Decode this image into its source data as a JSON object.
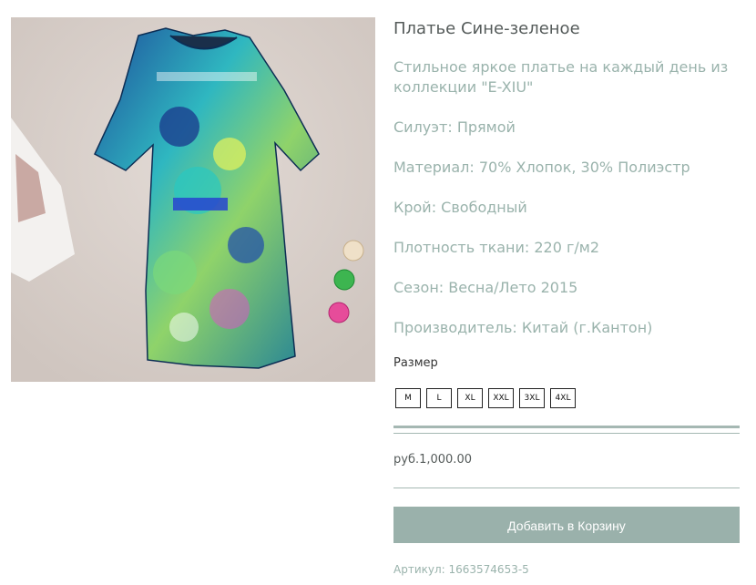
{
  "product": {
    "title": "Платье Сине-зеленое",
    "description": "Стильное яркое платье на каждый день из коллекции \"E-XIU\"",
    "specs": [
      "Силуэт: Прямой",
      "Материал: 70% Хлопок, 30% Полиэстр",
      "Крой: Свободный",
      "Плотность ткани: 220 г/м2",
      "Сезон: Весна/Лето 2015",
      "Производитель: Китай (г.Кантон)"
    ],
    "size_label": "Размер",
    "sizes": [
      "M",
      "L",
      "XL",
      "XXL",
      "3XL",
      "4XL"
    ],
    "price": "руб.1,000.00",
    "add_to_cart_label": "Добавить в Корзину",
    "sku": "Артикул: 1663574653-5",
    "image_alt": "dress-photo"
  },
  "colors": {
    "accent": "#9ab1ab",
    "text_muted": "#9ab3ac",
    "title": "#555b5a"
  }
}
